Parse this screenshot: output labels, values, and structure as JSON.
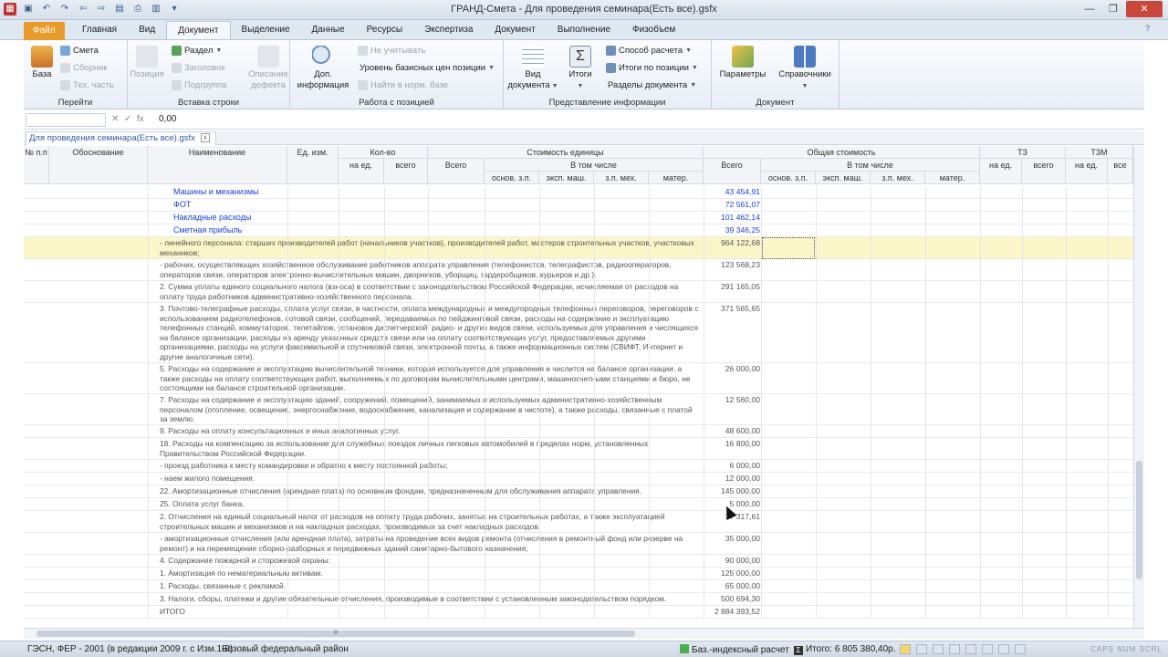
{
  "window": {
    "title": "ГРАНД-Смета - Для проведения семинара(Есть все).gsfx"
  },
  "tabs": [
    "Файл",
    "Главная",
    "Вид",
    "Документ",
    "Выделение",
    "Данные",
    "Ресурсы",
    "Экспертиза",
    "Документ",
    "Выполнение",
    "Физобъем"
  ],
  "ribbon": {
    "goto": {
      "label": "Перейти",
      "base": "База",
      "smeta": "Смета",
      "sbornik": "Сборник",
      "tech": "Тех. часть"
    },
    "insert": {
      "label": "Вставка строки",
      "pozicia": "Позиция",
      "razdel": "Раздел",
      "zagolovok": "Заголовок",
      "podrupa": "Подгруппа",
      "defect1": "Описание",
      "defect2": "дефекта"
    },
    "work": {
      "label": "Работа с позицией",
      "dop1": "Доп.",
      "dop2": "информация",
      "ne_uchit": "Не учитывать",
      "uroven": "Уровень базисных цен позиции",
      "naiti": "Найти в норм. базе"
    },
    "view": {
      "label": "Представление информации",
      "vid1": "Вид",
      "vid2": "документа",
      "itogi": "Итоги",
      "sposob": "Способ расчета",
      "itogi_poz": "Итоги по позиции",
      "razdely": "Разделы документа"
    },
    "document": {
      "label": "Документ",
      "params": "Параметры",
      "sprav": "Справочники"
    },
    "help": "?"
  },
  "formula": {
    "value": "0,00",
    "fx": "fx"
  },
  "doc_tab": {
    "label": "Для проведения семинара(Есть все).gsfx",
    "close": "x"
  },
  "headers": {
    "np": "№ п.п",
    "obosn": "Обоснование",
    "naim": "Наименование",
    "ed": "Ед. изм.",
    "kolvo": "Кол-во",
    "na_ed": "на ед.",
    "vsego": "всего",
    "stoim_ed": "Стоимость единицы",
    "vsego2": "Всего",
    "v_tom": "В том числе",
    "osn": "основ. з.п.",
    "eksp": "эксп. маш.",
    "zp_meh": "з.п. мех.",
    "mater": "матер.",
    "obsh": "Общая стоимость",
    "vsego3": "Всего",
    "v_tom2": "В том числе",
    "osn2": "основ. з.п.",
    "eksp2": "эксп. маш.",
    "zp_meh2": "з.п. мех.",
    "mater2": "матер.",
    "tz": "ТЗ",
    "tz_na": "на ед.",
    "tz_vs": "всего",
    "tzm": "ТЗМ",
    "tzm_na": "на ед.",
    "tzm_vs": "все"
  },
  "rows": [
    {
      "name": "Машины и механизмы",
      "total": "43 454,91",
      "blue": true
    },
    {
      "name": "ФОТ",
      "total": "72 561,07",
      "blue": true
    },
    {
      "name": "Накладные расходы",
      "total": "101 462,14",
      "blue": true
    },
    {
      "name": "Сметная прибыль",
      "total": "39 346,25",
      "blue": true
    },
    {
      "name": "- линейного персонала: старших производителей работ (начальников участков), производителей работ, мастеров строительных участков, участковых механиков;",
      "total": "964 122,68",
      "highlight": true
    },
    {
      "name": "- рабочих, осуществляющих хозяйственное обслуживание работников аппарата управления (телефонистов, телеграфистов, радиооператоров, операторов связи, операторов электронно-вычислительных машин, дворников, уборщиц, гардеробщиков, курьеров и др.).",
      "total": "123 568,23"
    },
    {
      "name": "2. Сумма уплаты единого социального налога (взноса) в соответствии с законодательством Российской Федерации, исчисляемая от расходов на оплату труда работников административно-хозяйственного персонала.",
      "total": "291 165,05"
    },
    {
      "name": "3. Почтово-телеграфные расходы, оплата услуг связи, в частности, оплата международных и междугородных телефонных переговоров, переговоров с использованием радиотелефонов, сотовой связи, сообщений, передаваемых по пейджинговой связи, расходы на содержание и эксплуатацию телефонных станций, коммутаторов, телетайпов, установок диспетчерской, радио- и других видов связи, используемых для управления и числящихся на балансе организации, расходы на аренду указанных средств связи или на оплату соответствующих услуг, предоставляемых другими организациями, расходы на услуги факсимильной и спутниковой связи, электронной почты, а также информационных систем (СВИФТ, Интернет и другие аналогичные сети).",
      "total": "371 565,65"
    },
    {
      "name": "5. Расходы на содержание и эксплуатацию вычислительной техники, которая используется для управления и числится на балансе организации, а также расходы на оплату соответствующих работ, выполняемых по договорам вычислительными центрами, машиносчетными станциями и бюро, не состоящими на балансе строительной организации.",
      "total": "26 000,00"
    },
    {
      "name": "7. Расходы на содержание и эксплуатацию зданий, сооружений, помещений, занимаемых и используемых административно-хозяйственным персоналом (отопление, освещение, энергоснабжение, водоснабжение, канализация и содержание в чистоте), а также расходы, связанные с платой за землю.",
      "total": "12 560,00"
    },
    {
      "name": "9. Расходы на оплату консультационных и иных аналогичных услуг.",
      "total": "48 600,00"
    },
    {
      "name": "18. Расходы на компенсацию за использование для служебных поездок личных легковых автомобилей в пределах норм, установленных Правительством Российской Федерации.",
      "total": "16 800,00"
    },
    {
      "name": "- проезд работника к месту командировки и обратно к месту постоянной работы;",
      "total": "6 000,00"
    },
    {
      "name": "- наем жилого помещения.",
      "total": "12 000,00"
    },
    {
      "name": "22. Амортизационные отчисления (арендная плата) по основным фондам, предназначенным для обслуживания аппарата управления.",
      "total": "145 000,00"
    },
    {
      "name": "25. Оплата услуг банка.",
      "total": "5 000,00"
    },
    {
      "name": "2. Отчисления на единый социальный налог от расходов на оплату труда рабочих, занятых на строительных работах, а также эксплуатацией строительных машин и механизмов и на накладных расходах, производимых за счет накладных расходов.",
      "total": "37 317,61"
    },
    {
      "name": "- амортизационные отчисления (или арендная плата), затраты на проведение всех видов ремонта (отчисления в ремонтный фонд или резерве на ремонт) и на перемещение сборно-разборных и передвижных зданий санитарно-бытового назначения;",
      "total": "35 000,00"
    },
    {
      "name": "4. Содержание пожарной и сторожевой охраны:",
      "total": "90 000,00"
    },
    {
      "name": "1. Амортизация по нематериальным активам.",
      "total": "125 000,00"
    },
    {
      "name": "1. Расходы, связанные с рекламой.",
      "total": "65 000,00"
    },
    {
      "name": "3. Налоги, сборы, платежи и другие обязательные отчисления, производимые в соответствии с установленным законодательством порядком.",
      "total": "500 694,30"
    },
    {
      "name": "ИТОГО",
      "total": "2 884 393,52"
    }
  ],
  "status": {
    "norms": "ГЭСН, ФЕР - 2001 (в редакции 2009 г. с Изм.1-8)",
    "region": "Базовый федеральный район",
    "calc": "Баз.-индексный расчет",
    "itogo": "Итого: 6 805 380,40р.",
    "keys": "CAPS NUM SCRL"
  },
  "hscroll_label": "III"
}
